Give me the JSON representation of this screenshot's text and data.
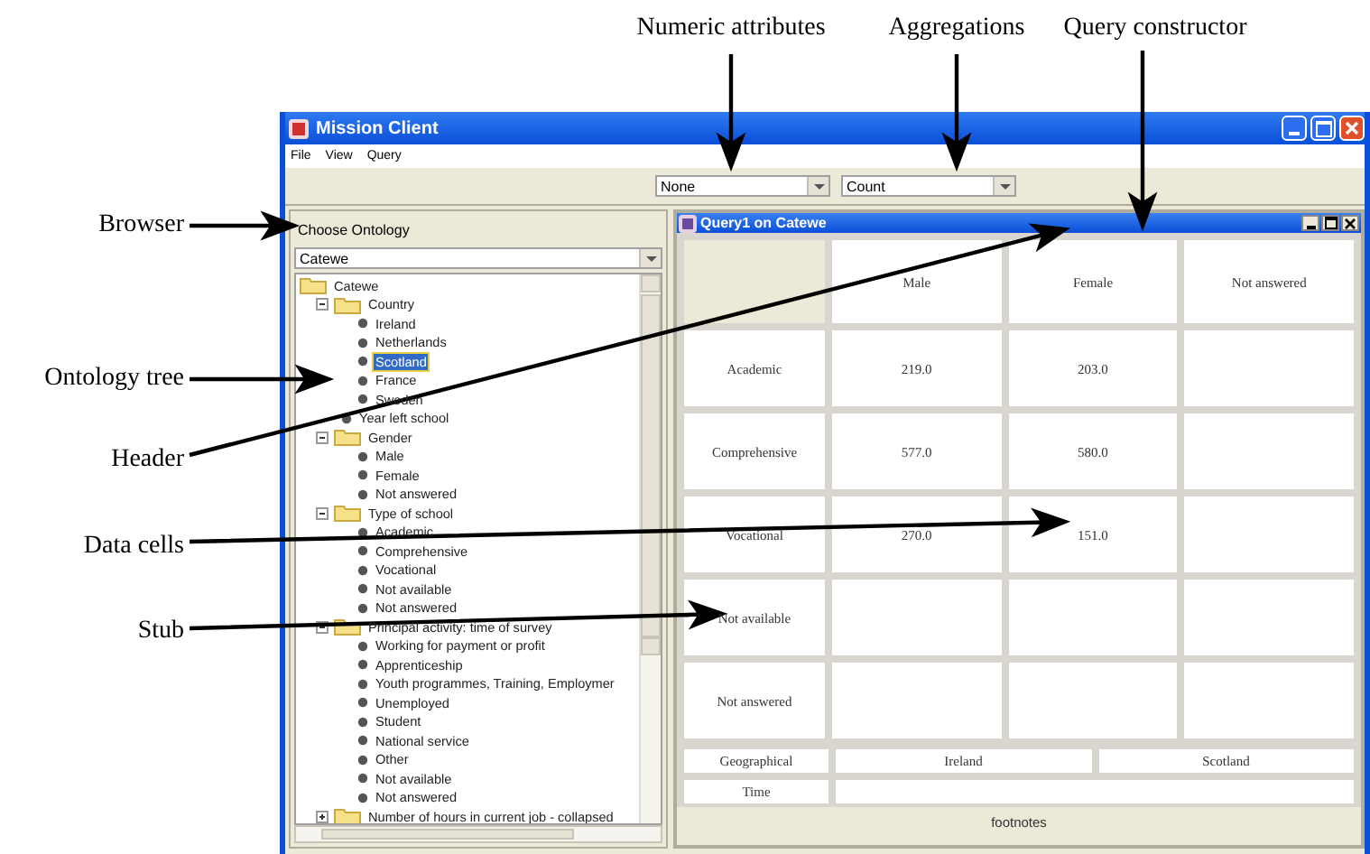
{
  "annotations": [
    {
      "text": "Numeric attributes"
    },
    {
      "text": "Aggregations"
    },
    {
      "text": "Query constructor"
    },
    {
      "text": "Browser"
    },
    {
      "text": "Ontology tree"
    },
    {
      "text": "Header"
    },
    {
      "text": "Data cells"
    },
    {
      "text": "Stub"
    }
  ],
  "window": {
    "title": "Mission Client"
  },
  "menu": [
    "File",
    "View",
    "Query"
  ],
  "toolbar": {
    "numeric_attribute": "None",
    "aggregation": "Count"
  },
  "browser": {
    "header": "Choose Ontology",
    "ontology": "Catewe",
    "tree": [
      {
        "label": "Catewe",
        "kind": "folder",
        "selected": false,
        "children": [
          {
            "label": "Country",
            "kind": "folder",
            "expanded": true,
            "selected": false,
            "children": [
              {
                "label": "Ireland",
                "kind": "leaf",
                "selected": false
              },
              {
                "label": "Netherlands",
                "kind": "leaf",
                "selected": false
              },
              {
                "label": "Scotland",
                "kind": "leaf",
                "selected": true
              },
              {
                "label": "France",
                "kind": "leaf",
                "selected": false
              },
              {
                "label": "Sweden",
                "kind": "leaf",
                "selected": false
              }
            ]
          },
          {
            "label": "Year left school",
            "kind": "leaf",
            "selected": false
          },
          {
            "label": "Gender",
            "kind": "folder",
            "expanded": true,
            "selected": false,
            "children": [
              {
                "label": "Male",
                "kind": "leaf",
                "selected": false
              },
              {
                "label": "Female",
                "kind": "leaf",
                "selected": false
              },
              {
                "label": "Not answered",
                "kind": "leaf",
                "selected": false
              }
            ]
          },
          {
            "label": "Type of school",
            "kind": "folder",
            "expanded": true,
            "selected": false,
            "children": [
              {
                "label": "Academic",
                "kind": "leaf",
                "selected": false
              },
              {
                "label": "Comprehensive",
                "kind": "leaf",
                "selected": false
              },
              {
                "label": "Vocational",
                "kind": "leaf",
                "selected": false
              },
              {
                "label": "Not available",
                "kind": "leaf",
                "selected": false
              },
              {
                "label": "Not answered",
                "kind": "leaf",
                "selected": false
              }
            ]
          },
          {
            "label": "Principal activity: time of survey",
            "kind": "folder",
            "expanded": true,
            "selected": false,
            "children": [
              {
                "label": "Working for payment or profit",
                "kind": "leaf",
                "selected": false
              },
              {
                "label": "Apprenticeship",
                "kind": "leaf",
                "selected": false
              },
              {
                "label": "Youth programmes, Training, Employmer",
                "kind": "leaf",
                "selected": false
              },
              {
                "label": "Unemployed",
                "kind": "leaf",
                "selected": false
              },
              {
                "label": "Student",
                "kind": "leaf",
                "selected": false
              },
              {
                "label": "National service",
                "kind": "leaf",
                "selected": false
              },
              {
                "label": "Other",
                "kind": "leaf",
                "selected": false
              },
              {
                "label": "Not available",
                "kind": "leaf",
                "selected": false
              },
              {
                "label": "Not answered",
                "kind": "leaf",
                "selected": false
              }
            ]
          },
          {
            "label": "Number of hours in current job - collapsed",
            "kind": "folder",
            "expanded": false,
            "selected": false
          }
        ]
      }
    ]
  },
  "query_window": {
    "title": "Query1 on Catewe",
    "columns": [
      "Male",
      "Female",
      "Not answered"
    ],
    "rows": [
      {
        "stub": "Academic",
        "cells": [
          "219.0",
          "203.0"
        ]
      },
      {
        "stub": "Comprehensive",
        "cells": [
          "577.0",
          "580.0"
        ]
      },
      {
        "stub": "Vocational",
        "cells": [
          "270.0",
          "151.0"
        ]
      },
      {
        "stub": "Not available",
        "cells": []
      },
      {
        "stub": "Not answered",
        "cells": []
      }
    ],
    "geographical": {
      "label": "Geographical",
      "values": [
        "Ireland",
        "Scotland"
      ]
    },
    "time": {
      "label": "Time"
    },
    "footnotes": "footnotes"
  }
}
